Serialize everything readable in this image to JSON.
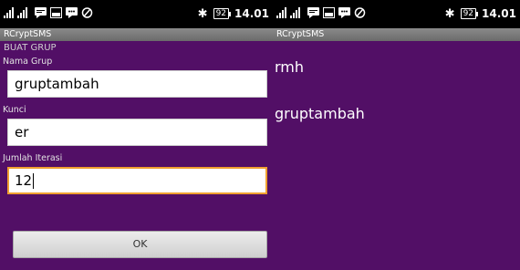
{
  "statusbar": {
    "time": "14.01",
    "battery": "92",
    "icons": [
      "signal-icon",
      "chat-icon",
      "image-icon",
      "message-icon",
      "sync-icon"
    ],
    "bluetooth_icon": "bluetooth-icon"
  },
  "left_screen": {
    "app_title": "RCryptSMS",
    "section_heading": "BUAT GRUP",
    "group_name": {
      "label": "Nama Grup",
      "value": "gruptambah"
    },
    "key": {
      "label": "Kunci",
      "value": "er"
    },
    "iterations": {
      "label": "Jumlah Iterasi",
      "value": "12"
    },
    "ok_label": "OK"
  },
  "right_screen": {
    "app_title": "RCryptSMS",
    "groups": [
      "rmh",
      "gruptambah"
    ]
  },
  "colors": {
    "background": "#520f66",
    "titlebar": "#7a7a7a",
    "focus_border": "#f0a030"
  }
}
